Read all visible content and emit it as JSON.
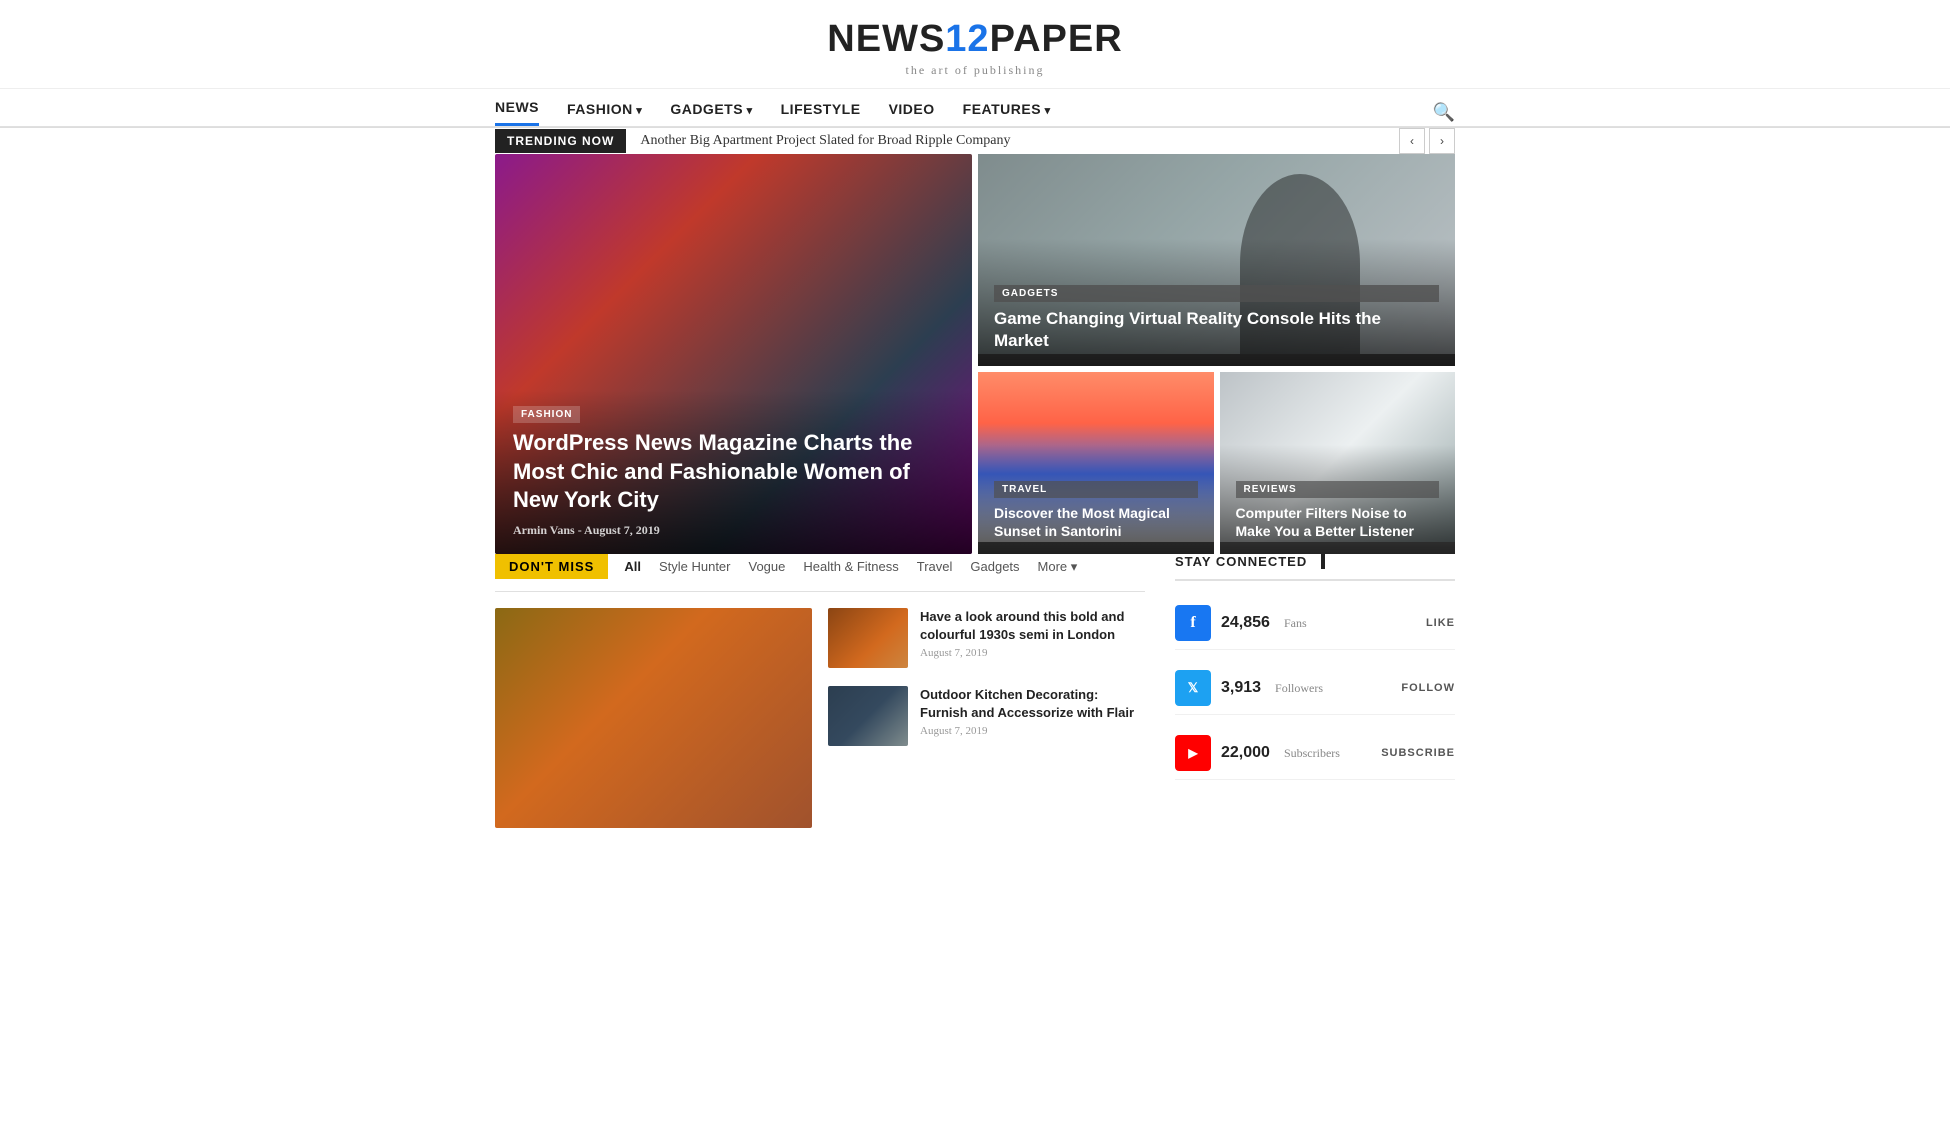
{
  "header": {
    "logo_text_news": "NEWS",
    "logo_text_num": "12",
    "logo_text_paper": "PAPER",
    "tagline": "the art of publishing"
  },
  "nav": {
    "items": [
      {
        "label": "NEWS",
        "active": true,
        "has_arrow": false
      },
      {
        "label": "FASHION",
        "active": false,
        "has_arrow": true
      },
      {
        "label": "GADGETS",
        "active": false,
        "has_arrow": true
      },
      {
        "label": "LIFESTYLE",
        "active": false,
        "has_arrow": false
      },
      {
        "label": "VIDEO",
        "active": false,
        "has_arrow": false
      },
      {
        "label": "FEATURES",
        "active": false,
        "has_arrow": true
      }
    ]
  },
  "trending": {
    "label": "TRENDING NOW",
    "text": "Another Big Apartment Project Slated for Broad Ripple Company"
  },
  "featured": {
    "left": {
      "category": "FASHION",
      "title": "WordPress News Magazine Charts the Most Chic and Fashionable Women of New York City",
      "author": "Armin Vans",
      "date": "August 7, 2019"
    },
    "right_top": {
      "category": "GADGETS",
      "title": "Game Changing Virtual Reality Console Hits the Market"
    },
    "right_bl": {
      "category": "TRAVEL",
      "title": "Discover the Most Magical Sunset in Santorini"
    },
    "right_br": {
      "category": "REVIEWS",
      "title": "Computer Filters Noise to Make You a Better Listener"
    }
  },
  "dont_miss": {
    "label": "DON'T MISS",
    "filters": [
      "All",
      "Style Hunter",
      "Vogue",
      "Health & Fitness",
      "Travel",
      "Gadgets",
      "More"
    ],
    "active_filter": "All",
    "articles": [
      {
        "title": "Have a look around this bold and colourful 1930s semi in London",
        "date": "August 7, 2019"
      },
      {
        "title": "Outdoor Kitchen Decorating: Furnish and Accessorize with Flair",
        "date": "August 7, 2019"
      }
    ]
  },
  "stay_connected": {
    "label": "STAY CONNECTED",
    "social": [
      {
        "platform": "Facebook",
        "icon": "f",
        "count": "24,856",
        "type": "Fans",
        "action": "LIKE",
        "color": "fb"
      },
      {
        "platform": "Twitter",
        "icon": "𝕏",
        "count": "3,913",
        "type": "Followers",
        "action": "FOLLOW",
        "color": "tw"
      },
      {
        "platform": "YouTube",
        "icon": "▶",
        "count": "22,000",
        "type": "Subscribers",
        "action": "SUBSCRIBE",
        "color": "yt"
      }
    ]
  }
}
